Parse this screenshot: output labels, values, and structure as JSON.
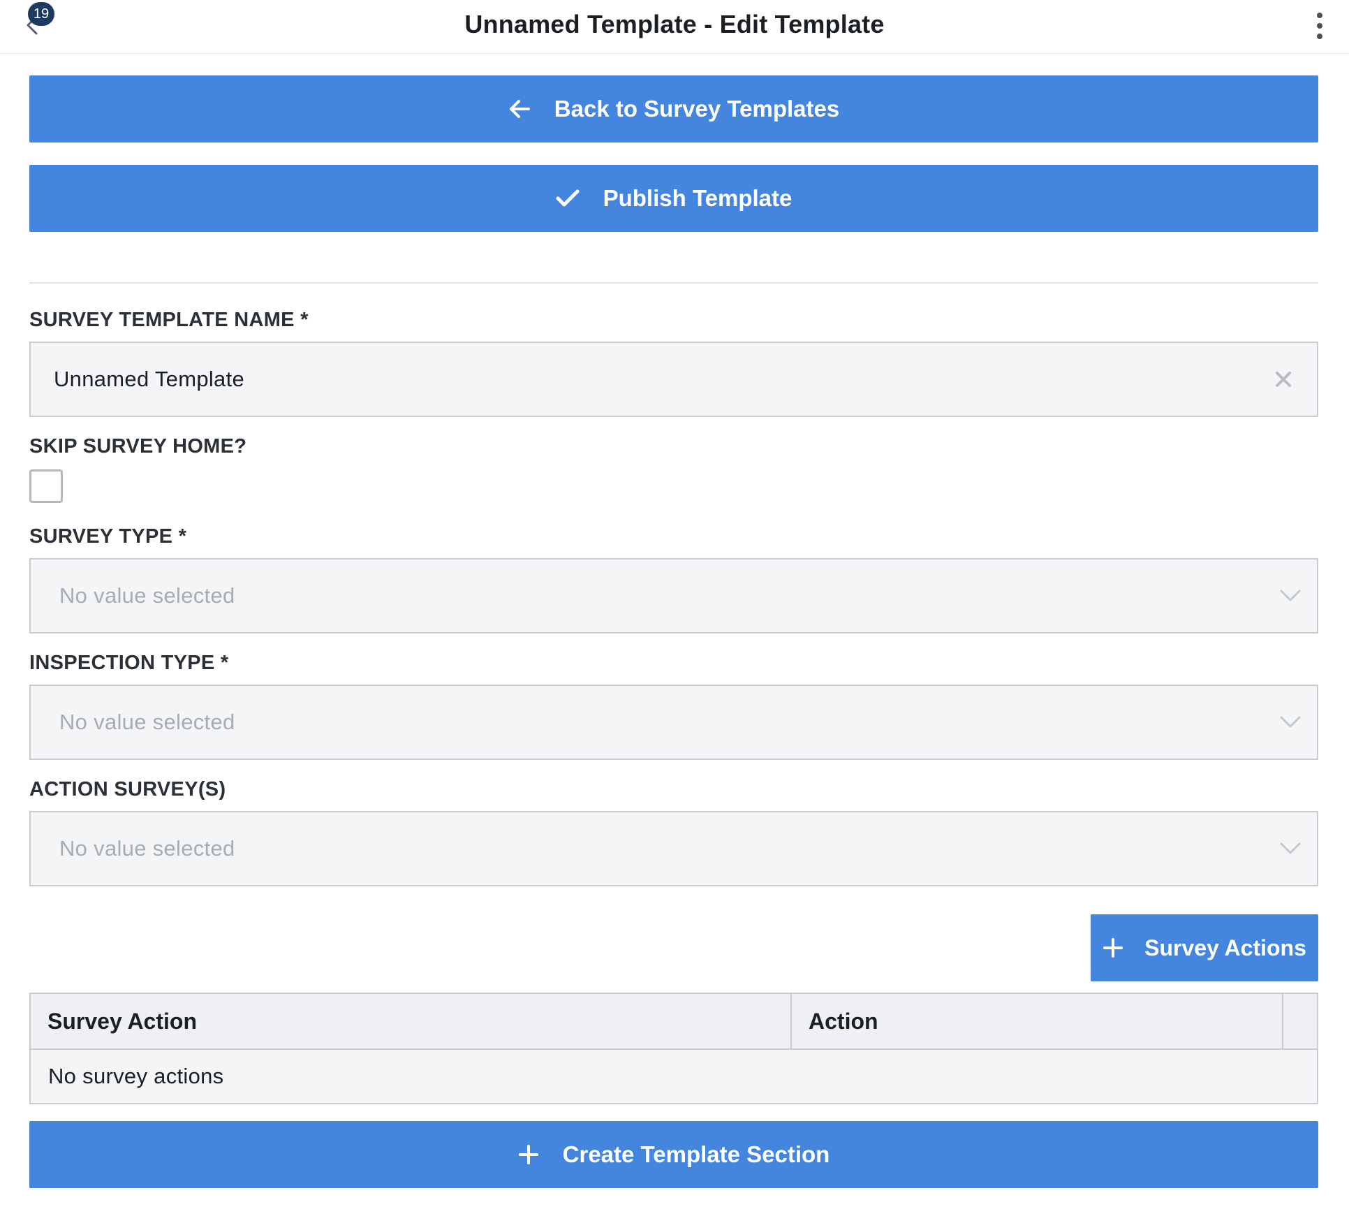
{
  "header": {
    "badge_count": "19",
    "title": "Unnamed Template - Edit Template"
  },
  "buttons": {
    "back_label": "Back to Survey Templates",
    "publish_label": "Publish Template",
    "survey_actions_label": "Survey Actions",
    "create_section_label": "Create Template Section"
  },
  "form": {
    "name_label": "SURVEY TEMPLATE NAME *",
    "name_value": "Unnamed Template",
    "skip_label": "SKIP SURVEY HOME?",
    "skip_checked": false,
    "survey_type_label": "SURVEY TYPE *",
    "survey_type_placeholder": "No value selected",
    "inspection_type_label": "INSPECTION TYPE *",
    "inspection_type_placeholder": "No value selected",
    "action_surveys_label": "ACTION SURVEY(S)",
    "action_surveys_placeholder": "No value selected"
  },
  "table": {
    "columns": [
      "Survey Action",
      "Action"
    ],
    "empty_text": "No survey actions"
  },
  "colors": {
    "primary": "#4486dd",
    "badge": "#1c3b5e",
    "field_bg": "#f4f5f7",
    "border": "#c9ccd1",
    "placeholder": "#a7acb3"
  }
}
